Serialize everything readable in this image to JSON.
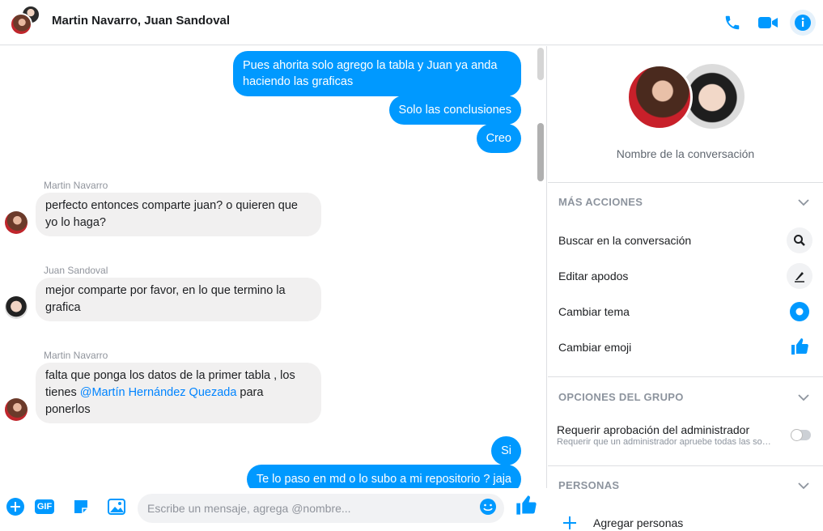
{
  "header": {
    "title": "Martin Navarro, Juan Sandoval",
    "icons": [
      "phone-icon",
      "video-icon",
      "info-icon"
    ],
    "accent": "#0099ff"
  },
  "messages": [
    {
      "dir": "out",
      "text_lines": [
        "Pues ahorita solo agrego la tabla y Juan ya anda",
        "haciendo las graficas"
      ]
    },
    {
      "dir": "out",
      "text": "Solo las conclusiones"
    },
    {
      "dir": "out",
      "text": "Creo"
    },
    {
      "dir": "in",
      "sender": "Martin Navarro",
      "text_lines": [
        "perfecto entonces comparte juan? o quieren que",
        "yo lo haga?"
      ]
    },
    {
      "dir": "in",
      "sender": "Juan Sandoval",
      "text_lines": [
        "mejor comparte por favor, en lo que termino la",
        "grafica"
      ]
    },
    {
      "dir": "in",
      "sender": "Martin Navarro",
      "line1": "falta que ponga los datos de la primer tabla , los",
      "line2_pre": "tienes ",
      "mention": "@Martín Hernández Quezada",
      "line2_post": " para",
      "line3": "ponerlos"
    },
    {
      "dir": "out",
      "text": "Si"
    },
    {
      "dir": "out",
      "text": "Te lo paso en md o lo subo a mi repositorio ? jaja"
    }
  ],
  "composer": {
    "placeholder": "Escribe un mensaje, agrega @nombre...",
    "tools": [
      "plus-icon",
      "gif-icon",
      "sticker-icon",
      "image-icon"
    ],
    "gif_label": "GIF"
  },
  "sidebar": {
    "conversation_name": "Nombre de la conversación",
    "more_actions": {
      "title": "MÁS ACCIONES",
      "items": [
        "Buscar en la conversación",
        "Editar apodos",
        "Cambiar tema",
        "Cambiar emoji"
      ]
    },
    "group_options": {
      "title": "OPCIONES DEL GRUPO",
      "require_title": "Requerir aprobación del administrador",
      "require_sub": "Requerir que un administrador apruebe todas las solicitudes",
      "require_enabled": false
    },
    "people": {
      "title": "PERSONAS",
      "add_label": "Agregar personas"
    }
  }
}
